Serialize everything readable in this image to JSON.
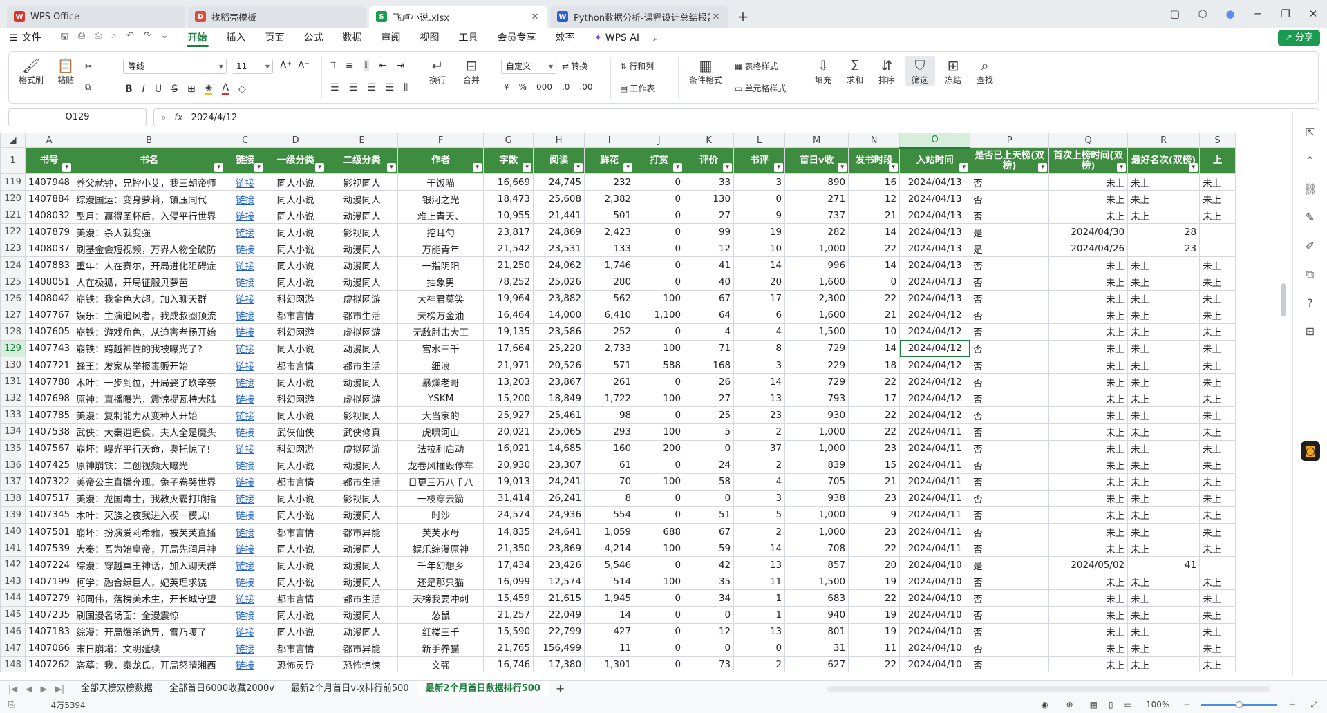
{
  "tabs": [
    {
      "label": "WPS Office",
      "icon": "W",
      "color": "#d9342b"
    },
    {
      "label": "找稻壳模板",
      "icon": "D",
      "color": "#e04a3a"
    },
    {
      "label": "飞卢小说.xlsx",
      "icon": "S",
      "color": "#1b9b50"
    },
    {
      "label": "Python数据分析-课程设计总结报告",
      "icon": "W",
      "color": "#2b5fd9"
    }
  ],
  "menu": {
    "file": "文件",
    "items": [
      "开始",
      "插入",
      "页面",
      "公式",
      "数据",
      "审阅",
      "视图",
      "工具",
      "会员专享",
      "效率"
    ],
    "wps_ai": "WPS AI",
    "share": "分享"
  },
  "ribbon": {
    "format_painter": "格式刷",
    "paste": "粘贴",
    "font": "等线",
    "font_size": "11",
    "wrap": "换行",
    "merge": "合并",
    "number_format": "自定义",
    "convert": "转换",
    "row_col": "行和列",
    "worksheet": "工作表",
    "cond_format": "条件格式",
    "table_style": "表格样式",
    "cell_style": "单元格样式",
    "fill": "填充",
    "sum": "求和",
    "sort": "排序",
    "filter": "筛选",
    "freeze": "冻结",
    "find": "查找"
  },
  "formula_bar": {
    "cell_ref": "O129",
    "fx": "fx",
    "value": "2024/4/12"
  },
  "columns": [
    "A",
    "B",
    "C",
    "D",
    "E",
    "F",
    "G",
    "H",
    "I",
    "J",
    "K",
    "L",
    "M",
    "N",
    "O",
    "P",
    "Q",
    "R",
    "S"
  ],
  "header": [
    "书号",
    "书名",
    "链接",
    "一级分类",
    "二级分类",
    "作者",
    "字数",
    "阅读",
    "鲜花",
    "打赏",
    "评价",
    "书评",
    "首日v收",
    "发书时段",
    "入站时间",
    "是否已上天榜(双榜)",
    "首次上榜时间(双榜)",
    "最好名次(双榜)",
    "上"
  ],
  "rows": [
    [
      "119",
      "1407948",
      "养父就钟，兄控小艾，我三朝帝师",
      "链接",
      "同人小说",
      "影视同人",
      "干饭喵",
      "16,669",
      "24,745",
      "232",
      "0",
      "33",
      "3",
      "890",
      "16",
      "2024/04/13",
      "否",
      "未上",
      "未上",
      "未上"
    ],
    [
      "120",
      "1407884",
      "综漫国运：变身萝莉，镇压同代",
      "链接",
      "同人小说",
      "动漫同人",
      "银河之光",
      "18,473",
      "25,608",
      "2,382",
      "0",
      "130",
      "0",
      "271",
      "12",
      "2024/04/13",
      "否",
      "未上",
      "未上",
      "未上"
    ],
    [
      "121",
      "1408032",
      "型月：赢得圣杯后，入侵平行世界",
      "链接",
      "同人小说",
      "动漫同人",
      "难上青天、",
      "10,955",
      "21,441",
      "501",
      "0",
      "27",
      "9",
      "737",
      "21",
      "2024/04/13",
      "否",
      "未上",
      "未上",
      "未上"
    ],
    [
      "122",
      "1407879",
      "美漫：杀人就变强",
      "链接",
      "同人小说",
      "影视同人",
      "挖耳勺",
      "23,817",
      "24,869",
      "2,423",
      "0",
      "99",
      "19",
      "282",
      "14",
      "2024/04/13",
      "是",
      "2024/04/30",
      "28",
      ""
    ],
    [
      "123",
      "1408037",
      "刷基金会短视频，万界人物全破防",
      "链接",
      "同人小说",
      "动漫同人",
      "万能青年",
      "21,542",
      "23,531",
      "133",
      "0",
      "12",
      "10",
      "1,000",
      "22",
      "2024/04/13",
      "是",
      "2024/04/26",
      "23",
      ""
    ],
    [
      "124",
      "1407883",
      "重年：人在赛尔，开局进化阻碍症",
      "链接",
      "同人小说",
      "动漫同人",
      "一指阴阳",
      "21,250",
      "24,062",
      "1,746",
      "0",
      "41",
      "14",
      "996",
      "14",
      "2024/04/13",
      "否",
      "未上",
      "未上",
      "未上"
    ],
    [
      "125",
      "1408051",
      "人在极狐，开局征服贝萝芭",
      "链接",
      "同人小说",
      "动漫同人",
      "抽象男",
      "78,252",
      "25,026",
      "280",
      "0",
      "40",
      "20",
      "1,600",
      "0",
      "2024/04/13",
      "否",
      "未上",
      "未上",
      "未上"
    ],
    [
      "126",
      "1408042",
      "崩铁：我金色大超，加入聊天群",
      "链接",
      "科幻网游",
      "虚拟网游",
      "大神君莫笑",
      "19,964",
      "23,882",
      "562",
      "100",
      "67",
      "17",
      "2,300",
      "22",
      "2024/04/13",
      "否",
      "未上",
      "未上",
      "未上"
    ],
    [
      "127",
      "1407767",
      "娱乐：主演追风者，我成叔圈顶流",
      "链接",
      "都市言情",
      "都市生活",
      "天榜万金油",
      "16,464",
      "14,000",
      "6,410",
      "1,100",
      "64",
      "6",
      "1,600",
      "21",
      "2024/04/12",
      "否",
      "未上",
      "未上",
      "未上"
    ],
    [
      "128",
      "1407605",
      "崩铁：游戏角色，从迫害老杨开始",
      "链接",
      "科幻网游",
      "虚拟网游",
      "无敌肘击大王",
      "19,135",
      "23,586",
      "252",
      "0",
      "4",
      "4",
      "1,500",
      "10",
      "2024/04/12",
      "否",
      "未上",
      "未上",
      "未上"
    ],
    [
      "129",
      "1407743",
      "崩铁：跨越神性的我被曝光了?",
      "链接",
      "同人小说",
      "动漫同人",
      "宫水三千",
      "17,664",
      "25,220",
      "2,733",
      "100",
      "71",
      "8",
      "729",
      "14",
      "2024/04/12",
      "否",
      "未上",
      "未上",
      "未上"
    ],
    [
      "130",
      "1407721",
      "蜂王：发家从举报毒贩开始",
      "链接",
      "都市言情",
      "都市生活",
      "细浪",
      "21,971",
      "20,526",
      "571",
      "588",
      "168",
      "3",
      "229",
      "18",
      "2024/04/12",
      "否",
      "未上",
      "未上",
      "未上"
    ],
    [
      "131",
      "1407788",
      "木叶：一步到位，开局娶了玖辛奈",
      "链接",
      "同人小说",
      "动漫同人",
      "暴燥老哥",
      "13,203",
      "23,867",
      "261",
      "0",
      "26",
      "14",
      "729",
      "22",
      "2024/04/12",
      "否",
      "未上",
      "未上",
      "未上"
    ],
    [
      "132",
      "1407698",
      "原神：直播曝光，震惊提瓦特大陆",
      "链接",
      "科幻网游",
      "虚拟网游",
      "YSKM",
      "15,200",
      "18,849",
      "1,722",
      "100",
      "27",
      "13",
      "793",
      "17",
      "2024/04/12",
      "否",
      "未上",
      "未上",
      "未上"
    ],
    [
      "133",
      "1407785",
      "美漫：复制能力从变种人开始",
      "链接",
      "同人小说",
      "影视同人",
      "大当家的",
      "25,927",
      "25,461",
      "98",
      "0",
      "25",
      "23",
      "930",
      "22",
      "2024/04/12",
      "否",
      "未上",
      "未上",
      "未上"
    ],
    [
      "134",
      "1407538",
      "武侠：大秦逍遥侯，夫人全是魔头",
      "链接",
      "武侠仙侠",
      "武侠修真",
      "虎啸河山",
      "20,021",
      "25,065",
      "293",
      "100",
      "5",
      "2",
      "1,000",
      "22",
      "2024/04/11",
      "否",
      "未上",
      "未上",
      "未上"
    ],
    [
      "135",
      "1407567",
      "崩坏：曝光平行天命，奥托惊了!",
      "链接",
      "科幻网游",
      "虚拟网游",
      "法拉利启动",
      "16,021",
      "14,685",
      "160",
      "200",
      "0",
      "37",
      "1,000",
      "23",
      "2024/04/11",
      "否",
      "未上",
      "未上",
      "未上"
    ],
    [
      "136",
      "1407425",
      "原神崩铁：二创视频大曝光",
      "链接",
      "同人小说",
      "动漫同人",
      "龙卷风摧毁停车",
      "20,930",
      "23,307",
      "61",
      "0",
      "24",
      "2",
      "839",
      "15",
      "2024/04/11",
      "否",
      "未上",
      "未上",
      "未上"
    ],
    [
      "137",
      "1407322",
      "美帝公主直播奔现，兔子卷哭世界",
      "链接",
      "都市言情",
      "都市生活",
      "日更三万八千八",
      "19,013",
      "24,241",
      "70",
      "100",
      "58",
      "4",
      "705",
      "21",
      "2024/04/11",
      "否",
      "未上",
      "未上",
      "未上"
    ],
    [
      "138",
      "1407517",
      "美漫：龙国毒士，我教灭霸打响指",
      "链接",
      "同人小说",
      "影视同人",
      "一枝穿云箭",
      "31,414",
      "26,241",
      "8",
      "0",
      "0",
      "3",
      "938",
      "23",
      "2024/04/11",
      "否",
      "未上",
      "未上",
      "未上"
    ],
    [
      "139",
      "1407345",
      "木叶：灭族之夜我进入楔一模式!",
      "链接",
      "同人小说",
      "动漫同人",
      "时沙",
      "24,574",
      "24,936",
      "554",
      "0",
      "51",
      "5",
      "1,000",
      "9",
      "2024/04/11",
      "否",
      "未上",
      "未上",
      "未上"
    ],
    [
      "140",
      "1407501",
      "崩坏：扮演爱莉希雅，被芙芙直播",
      "链接",
      "都市言情",
      "都市异能",
      "芙芙水母",
      "14,835",
      "24,641",
      "1,059",
      "688",
      "67",
      "2",
      "1,000",
      "23",
      "2024/04/11",
      "否",
      "未上",
      "未上",
      "未上"
    ],
    [
      "141",
      "1407539",
      "大秦：吾为始皇帝，开局先润月神",
      "链接",
      "同人小说",
      "动漫同人",
      "娱乐综漫原神",
      "21,350",
      "23,869",
      "4,214",
      "100",
      "59",
      "14",
      "708",
      "22",
      "2024/04/11",
      "否",
      "未上",
      "未上",
      "未上"
    ],
    [
      "142",
      "1407224",
      "综漫：穿越冥王神话，加入聊天群",
      "链接",
      "同人小说",
      "动漫同人",
      "千年幻想乡",
      "17,434",
      "23,426",
      "5,546",
      "0",
      "42",
      "13",
      "857",
      "20",
      "2024/04/10",
      "是",
      "2024/05/02",
      "41",
      ""
    ],
    [
      "143",
      "1407199",
      "柯学：融合绿巨人，妃英理求饶",
      "链接",
      "同人小说",
      "动漫同人",
      "还是那只猫",
      "16,099",
      "12,574",
      "514",
      "100",
      "35",
      "11",
      "1,500",
      "19",
      "2024/04/10",
      "否",
      "未上",
      "未上",
      "未上"
    ],
    [
      "144",
      "1407279",
      "祁同伟，落榜美术生，开长城守望",
      "链接",
      "都市言情",
      "都市生活",
      "天榜我要冲刺",
      "15,459",
      "21,615",
      "1,945",
      "0",
      "34",
      "1",
      "683",
      "22",
      "2024/04/10",
      "否",
      "未上",
      "未上",
      "未上"
    ],
    [
      "145",
      "1407235",
      "刷国漫名场面：全漫震惊",
      "链接",
      "同人小说",
      "动漫同人",
      "怂鼠",
      "21,257",
      "22,049",
      "14",
      "0",
      "0",
      "1",
      "940",
      "19",
      "2024/04/10",
      "否",
      "未上",
      "未上",
      "未上"
    ],
    [
      "146",
      "1407183",
      "综漫：开局爆杀诡异，雪乃嗄了",
      "链接",
      "同人小说",
      "动漫同人",
      "红楼三千",
      "15,590",
      "22,799",
      "427",
      "0",
      "12",
      "13",
      "801",
      "19",
      "2024/04/10",
      "否",
      "未上",
      "未上",
      "未上"
    ],
    [
      "147",
      "1407066",
      "末日崩塌：文明延续",
      "链接",
      "都市言情",
      "都市异能",
      "新手养猫",
      "21,765",
      "156,499",
      "11",
      "0",
      "0",
      "0",
      "31",
      "11",
      "2024/04/10",
      "否",
      "未上",
      "未上",
      "未上"
    ],
    [
      "148",
      "1407262",
      "盗墓：我，泰龙氏，开局怒晴湘西",
      "链接",
      "恐怖灵异",
      "恐怖惊悚",
      "文强",
      "16,746",
      "17,380",
      "1,301",
      "0",
      "73",
      "2",
      "627",
      "22",
      "2024/04/10",
      "否",
      "未上",
      "未上",
      "未上"
    ]
  ],
  "sheets": [
    "全部天榜双榜数据",
    "全部首日6000收藏2000v",
    "最新2个月首日v收排行前500",
    "最新2个月首日数据排行500"
  ],
  "status": {
    "count": "4万5394",
    "zoom": "100%"
  }
}
